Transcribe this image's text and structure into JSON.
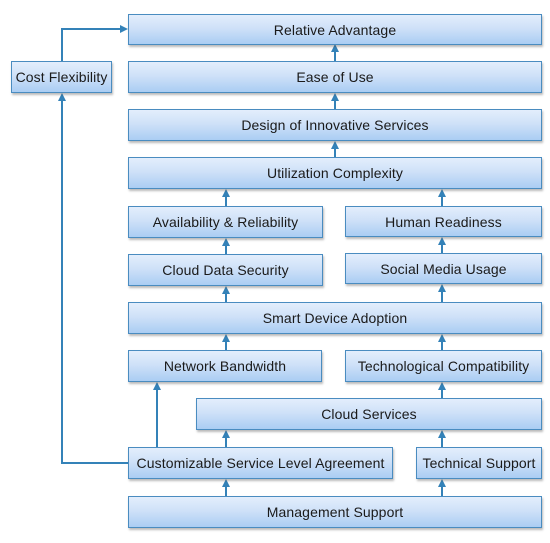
{
  "diagram": {
    "type": "flow-hierarchy",
    "nodes": {
      "relative_advantage": "Relative Advantage",
      "cost_flexibility": "Cost Flexibility",
      "ease_of_use": "Ease of Use",
      "design_of_innovative_services": "Design of Innovative Services",
      "utilization_complexity": "Utilization Complexity",
      "availability_reliability": "Availability & Reliability",
      "human_readiness": "Human Readiness",
      "cloud_data_security": "Cloud Data Security",
      "social_media_usage": "Social Media Usage",
      "smart_device_adoption": "Smart Device Adoption",
      "network_bandwidth": "Network Bandwidth",
      "technological_compatibility": "Technological Compatibility",
      "cloud_services": "Cloud Services",
      "customizable_sla": "Customizable Service Level Agreement",
      "technical_support": "Technical Support",
      "management_support": "Management Support"
    },
    "edges": [
      {
        "from": "management_support",
        "to": "customizable_sla"
      },
      {
        "from": "management_support",
        "to": "technical_support"
      },
      {
        "from": "customizable_sla",
        "to": "cloud_services"
      },
      {
        "from": "customizable_sla",
        "to": "network_bandwidth"
      },
      {
        "from": "customizable_sla",
        "to": "cost_flexibility"
      },
      {
        "from": "technical_support",
        "to": "cloud_services"
      },
      {
        "from": "cloud_services",
        "to": "technological_compatibility"
      },
      {
        "from": "network_bandwidth",
        "to": "smart_device_adoption"
      },
      {
        "from": "technological_compatibility",
        "to": "smart_device_adoption"
      },
      {
        "from": "smart_device_adoption",
        "to": "cloud_data_security"
      },
      {
        "from": "smart_device_adoption",
        "to": "social_media_usage"
      },
      {
        "from": "cloud_data_security",
        "to": "availability_reliability"
      },
      {
        "from": "social_media_usage",
        "to": "human_readiness"
      },
      {
        "from": "availability_reliability",
        "to": "utilization_complexity"
      },
      {
        "from": "human_readiness",
        "to": "utilization_complexity"
      },
      {
        "from": "utilization_complexity",
        "to": "design_of_innovative_services"
      },
      {
        "from": "design_of_innovative_services",
        "to": "ease_of_use"
      },
      {
        "from": "ease_of_use",
        "to": "relative_advantage"
      },
      {
        "from": "cost_flexibility",
        "to": "relative_advantage"
      }
    ],
    "colors": {
      "box_border": "#4a8cc0",
      "box_fill_top": "#e3eefc",
      "box_fill_bottom": "#aacdf3",
      "arrow": "#3482b8",
      "text": "#1a1a1a"
    }
  }
}
